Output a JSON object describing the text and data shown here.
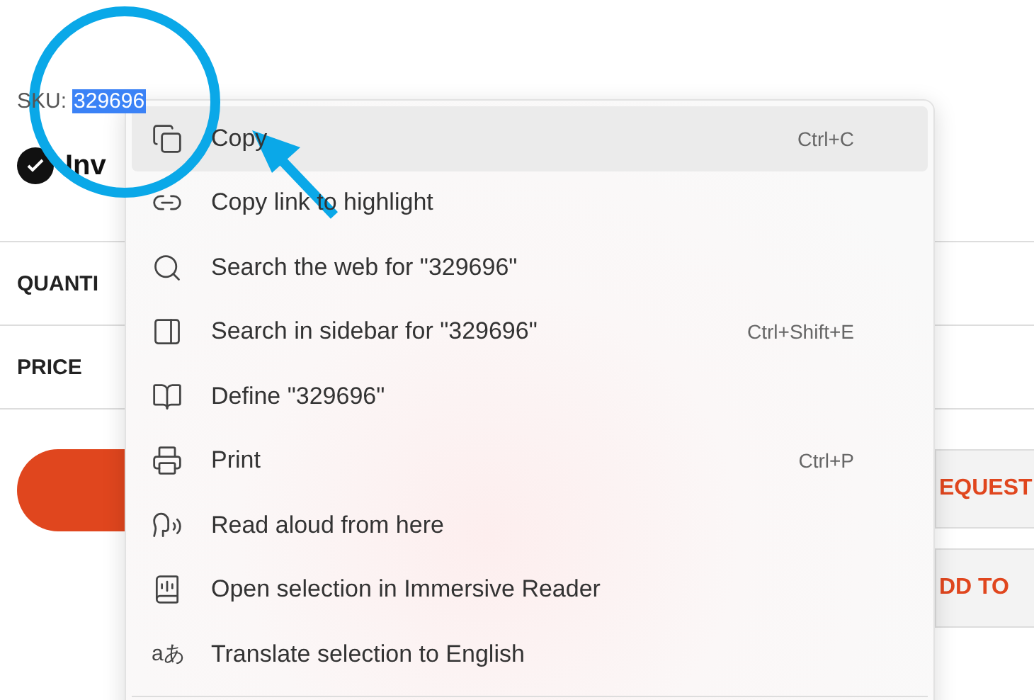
{
  "product": {
    "sku_label": "SKU:",
    "sku": "329696",
    "sku_selected": true,
    "status": "Inv",
    "rows": [
      "QUANTI",
      "PRICE"
    ],
    "buttons": [
      "EQUEST",
      "DD TO"
    ]
  },
  "context_menu": {
    "items": [
      {
        "kind": "copy",
        "label": "Copy",
        "shortcut": "Ctrl+C",
        "selected": true
      },
      {
        "kind": "link",
        "label": "Copy link to highlight",
        "selected": false
      },
      {
        "kind": "search",
        "label": "Search the web for \"329696\"",
        "selected": false
      },
      {
        "kind": "sidebar",
        "label": "Search in sidebar for \"329696\"",
        "shortcut": "Ctrl+Shift+E",
        "selected": false
      },
      {
        "kind": "define",
        "label": "Define \"329696\"",
        "selected": false
      },
      {
        "kind": "print",
        "label": "Print",
        "shortcut": "Ctrl+P",
        "selected": false
      },
      {
        "kind": "read",
        "label": "Read aloud from here",
        "selected": false
      },
      {
        "kind": "reader",
        "label": "Open selection in Immersive Reader",
        "selected": false
      },
      {
        "kind": "translate",
        "icon_text": "aあ",
        "label": "Translate selection to English",
        "selected": false
      }
    ]
  }
}
